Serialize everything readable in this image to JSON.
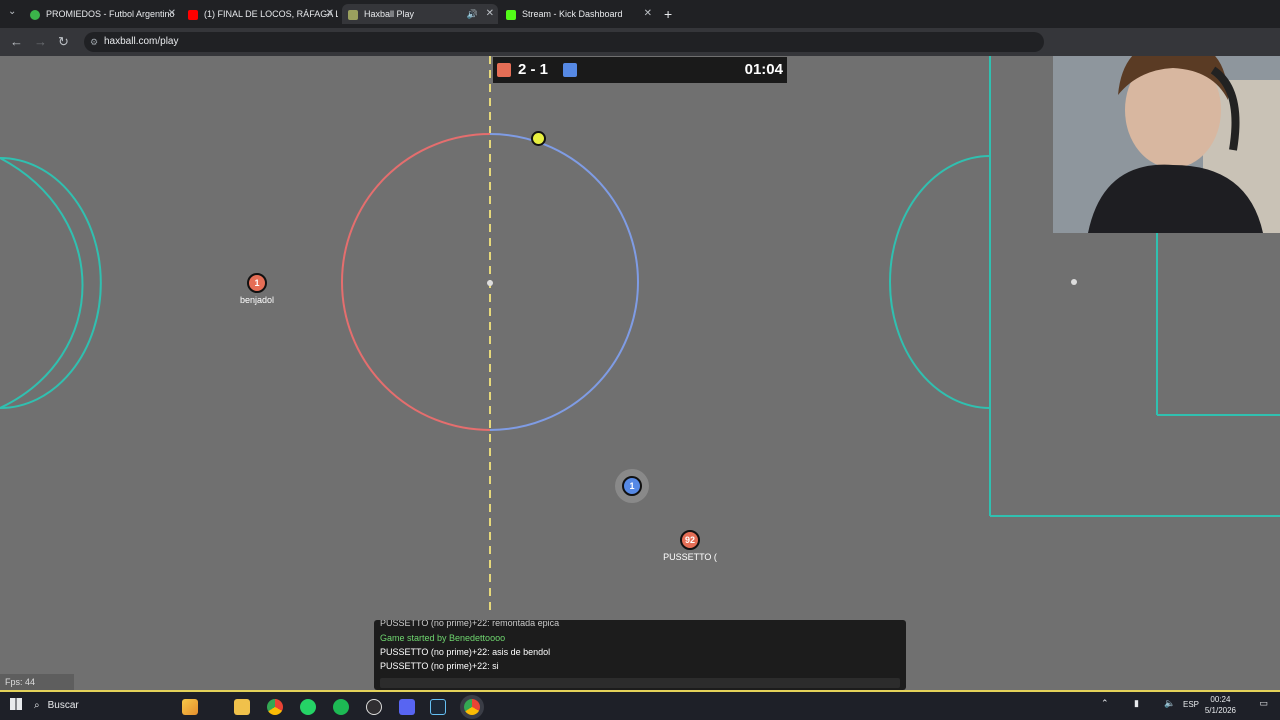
{
  "browser": {
    "tabs": [
      {
        "label": "PROMIEDOS - Futbol Argentino",
        "icon": "promiedos-icon",
        "active": false
      },
      {
        "label": "(1) FINAL DE LOCOS, RÁFAGA LI",
        "icon": "youtube-icon",
        "active": false
      },
      {
        "label": "Haxball Play",
        "icon": "haxball-icon",
        "active": true
      },
      {
        "label": "Stream - Kick Dashboard",
        "icon": "kick-icon",
        "active": false
      }
    ],
    "new_tab": "+",
    "url": "haxball.com/play"
  },
  "game": {
    "score": {
      "red": 2,
      "separator": "-",
      "blue": 1,
      "text": "2 - 1",
      "time": "01:04"
    },
    "colors": {
      "red": "#e56e56",
      "blue": "#5689e5",
      "field": "#707070",
      "lines": "#30c0b0",
      "ball": "#e8f040"
    },
    "players": [
      {
        "team": "red",
        "number": "1",
        "name": "benjadol"
      },
      {
        "team": "red",
        "number": "92",
        "name": "PUSSETTO ("
      },
      {
        "team": "blue",
        "number": "1",
        "name": ""
      }
    ],
    "chat": [
      "PUSSETTO (no prime)+22: remontada epica",
      "Game started by Benedettoooo",
      "PUSSETTO (no prime)+22: asis de bendol",
      "PUSSETTO (no prime)+22: si"
    ],
    "fps": "Fps: 44"
  },
  "taskbar": {
    "search_label": "Buscar",
    "apps": [
      "copilot-icon",
      "file-explorer-icon",
      "chrome-icon",
      "whatsapp-icon",
      "spotify-icon",
      "obs-icon",
      "discord-icon",
      "steam-icon",
      "chrome-active-icon"
    ],
    "language": "ESP",
    "time": "00:24",
    "date": "5/1/2026"
  }
}
